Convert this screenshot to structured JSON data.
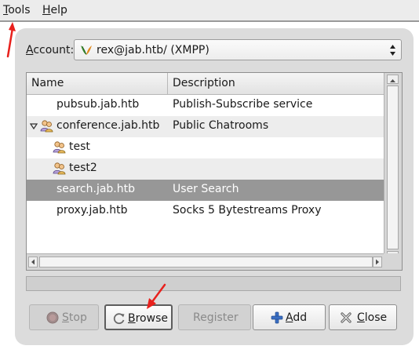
{
  "menubar": {
    "items": [
      {
        "label": "Tools"
      },
      {
        "label": "Help"
      }
    ]
  },
  "dialog": {
    "account_label": "Account:",
    "account_value": "rex@jab.htb/ (XMPP)"
  },
  "tree": {
    "columns": [
      "Name",
      "Description"
    ],
    "rows": [
      {
        "name": "pubsub.jab.htb",
        "description": "Publish-Subscribe service"
      },
      {
        "name": "conference.jab.htb",
        "description": "Public Chatrooms",
        "expanded": true
      },
      {
        "name": "test",
        "description": ""
      },
      {
        "name": "test2",
        "description": ""
      },
      {
        "name": "search.jab.htb",
        "description": "User Search",
        "selected": true
      },
      {
        "name": "proxy.jab.htb",
        "description": "Socks 5 Bytestreams Proxy"
      }
    ]
  },
  "buttons": {
    "stop": "Stop",
    "browse": "Browse",
    "register": "Register",
    "add": "Add",
    "close": "Close"
  },
  "colors": {
    "annotation_arrow": "#e8211d",
    "selection": "#979797"
  }
}
